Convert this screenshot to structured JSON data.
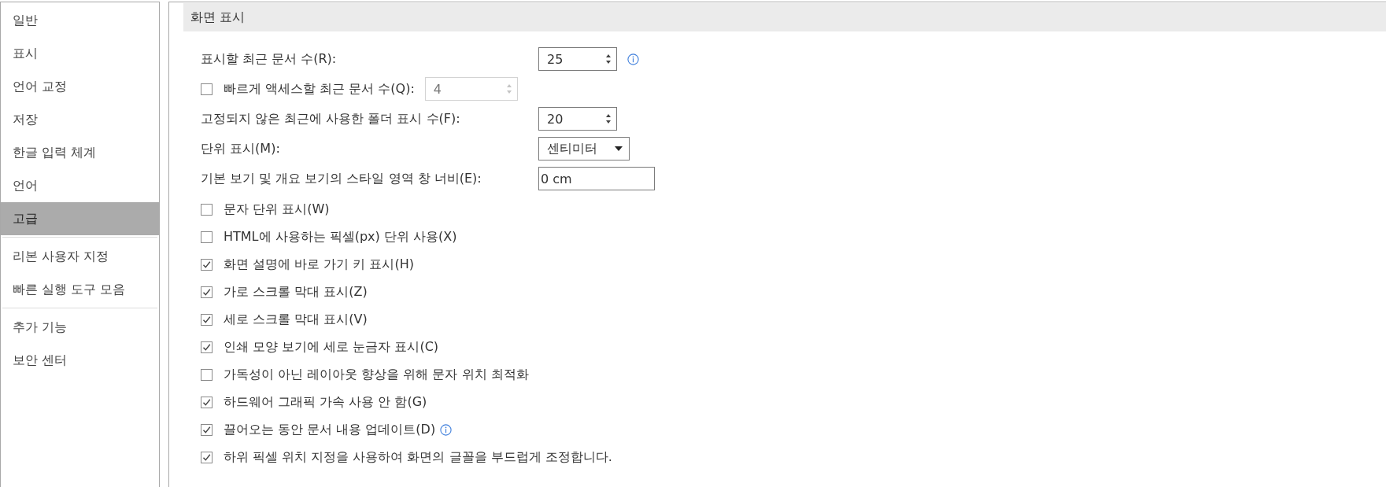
{
  "sidebar": {
    "groups": [
      {
        "items": [
          {
            "label": "일반",
            "selected": false
          },
          {
            "label": "표시",
            "selected": false
          },
          {
            "label": "언어 교정",
            "selected": false
          },
          {
            "label": "저장",
            "selected": false
          },
          {
            "label": "한글 입력 체계",
            "selected": false
          },
          {
            "label": "언어",
            "selected": false
          },
          {
            "label": "고급",
            "selected": true
          }
        ]
      },
      {
        "items": [
          {
            "label": "리본 사용자 지정",
            "selected": false
          },
          {
            "label": "빠른 실행 도구 모음",
            "selected": false
          }
        ]
      },
      {
        "items": [
          {
            "label": "추가 기능",
            "selected": false
          },
          {
            "label": "보안 센터",
            "selected": false
          }
        ]
      }
    ]
  },
  "section": {
    "title": "화면 표시",
    "settings": [
      {
        "kind": "spin",
        "label": "표시할 최근 문서 수(R):",
        "value": "25",
        "disabled": false,
        "info": true
      },
      {
        "kind": "check_spin",
        "label": "빠르게 액세스할 최근 문서 수(Q):",
        "checked": false,
        "value": "4",
        "disabled": true,
        "info": false
      },
      {
        "kind": "spin",
        "label": "고정되지 않은 최근에 사용한 폴더 표시 수(F):",
        "value": "20",
        "disabled": false,
        "info": false
      },
      {
        "kind": "dropdown",
        "label": "단위 표시(M):",
        "value": "센티미터",
        "info": false
      },
      {
        "kind": "text",
        "label": "기본 보기 및 개요 보기의 스타일 영역 창 너비(E):",
        "value": "0 cm",
        "info": false
      },
      {
        "kind": "check",
        "label": "문자 단위 표시(W)",
        "checked": false,
        "info": false
      },
      {
        "kind": "check",
        "label": "HTML에 사용하는 픽셀(px) 단위 사용(X)",
        "checked": false,
        "info": false
      },
      {
        "kind": "check",
        "label": "화면 설명에 바로 가기 키 표시(H)",
        "checked": true,
        "info": false
      },
      {
        "kind": "check",
        "label": "가로 스크롤 막대 표시(Z)",
        "checked": true,
        "info": false
      },
      {
        "kind": "check",
        "label": "세로 스크롤 막대 표시(V)",
        "checked": true,
        "info": false
      },
      {
        "kind": "check",
        "label": "인쇄 모양 보기에 세로 눈금자 표시(C)",
        "checked": true,
        "info": false
      },
      {
        "kind": "check",
        "label": "가독성이 아닌 레이아웃 향상을 위해 문자 위치 최적화",
        "checked": false,
        "info": false
      },
      {
        "kind": "check",
        "label": "하드웨어 그래픽 가속 사용 안 함(G)",
        "checked": true,
        "info": false
      },
      {
        "kind": "check",
        "label": "끌어오는 동안 문서 내용 업데이트(D)",
        "checked": true,
        "info": true
      },
      {
        "kind": "check",
        "label": "하위 픽셀 위치 지정을 사용하여 화면의 글꼴을 부드럽게 조정합니다.",
        "checked": true,
        "info": false
      }
    ]
  }
}
